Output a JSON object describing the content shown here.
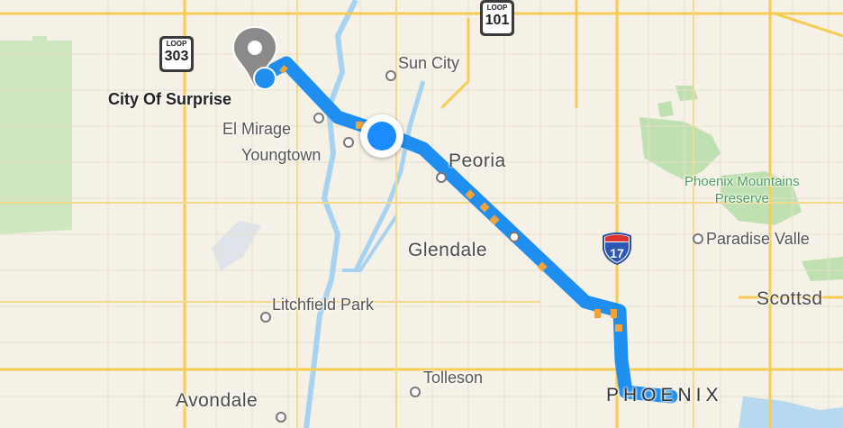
{
  "map": {
    "places": {
      "surprise": "City Of Surprise",
      "sun_city": "Sun City",
      "el_mirage": "El Mirage",
      "youngtown": "Youngtown",
      "peoria": "Peoria",
      "glendale": "Glendale",
      "litchfield_park": "Litchfield Park",
      "tolleson": "Tolleson",
      "avondale": "Avondale",
      "phoenix": "PHOENIX",
      "paradise_valley": "Paradise Valle",
      "scottsdale": "Scottsd"
    },
    "parks": {
      "phoenix_mountains_line1": "Phoenix Mountains",
      "phoenix_mountains_line2": "Preserve"
    },
    "shields": {
      "loop303_label": "LOOP",
      "loop303_number": "303",
      "loop101_label": "LOOP",
      "loop101_number": "101",
      "i17_number": "17"
    },
    "colors": {
      "route": "#1f8ef1",
      "traffic": "#f0a33a",
      "current_location": "#1a8cff",
      "destination_pin": "#8a8a8a",
      "park": "#bfe0b0",
      "water": "#a6d3f2",
      "major_road": "#f6cc55",
      "background": "#f6f1e6"
    }
  }
}
